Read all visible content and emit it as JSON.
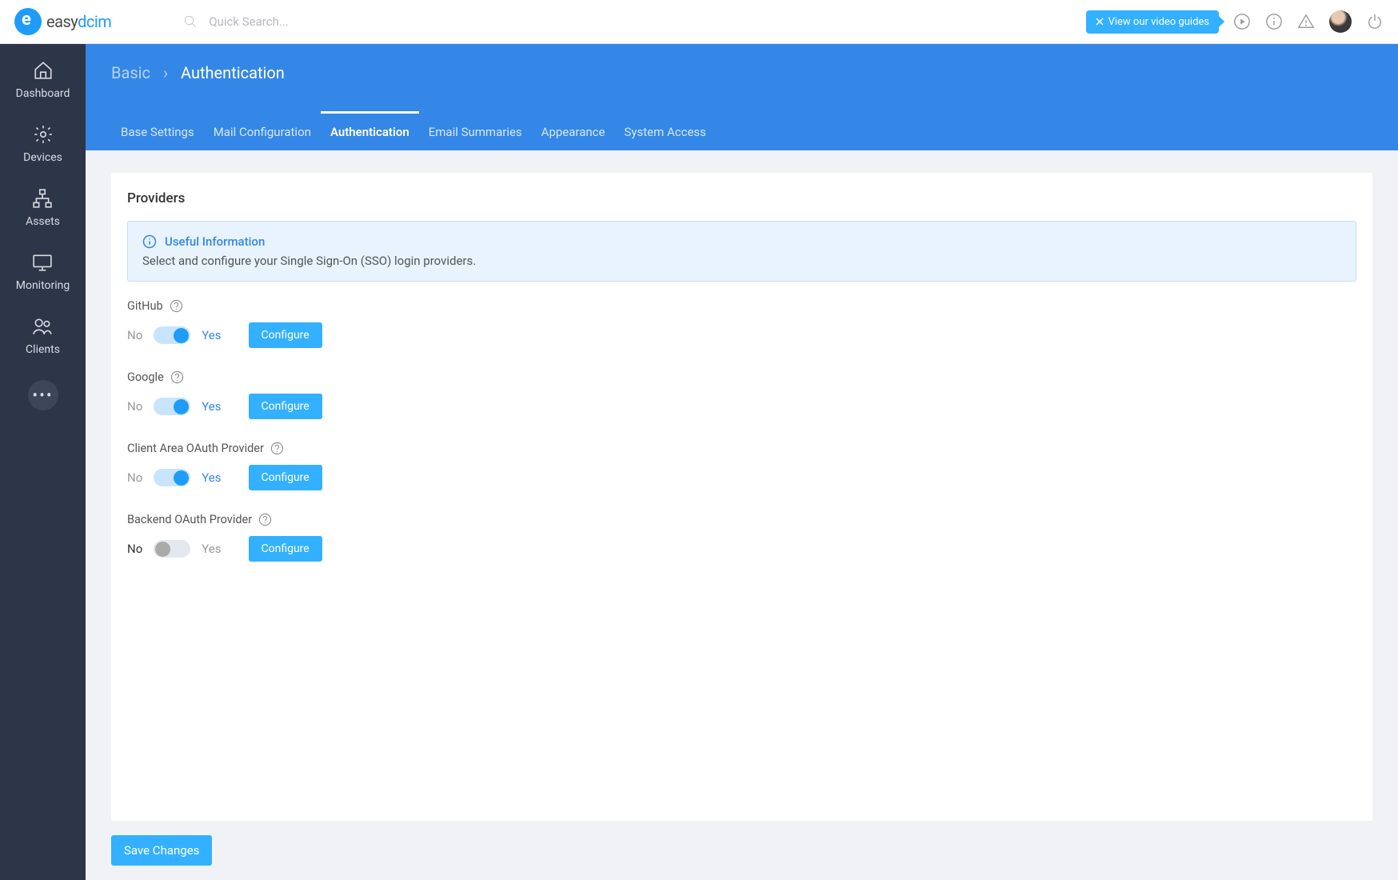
{
  "logo": {
    "text_easy": "easy",
    "text_dcim": "dcim"
  },
  "search": {
    "placeholder": "Quick Search..."
  },
  "header": {
    "video_guides": "View our video guides"
  },
  "sidebar": {
    "items": [
      {
        "label": "Dashboard"
      },
      {
        "label": "Devices"
      },
      {
        "label": "Assets"
      },
      {
        "label": "Monitoring"
      },
      {
        "label": "Clients"
      }
    ]
  },
  "breadcrumb": {
    "first": "Basic",
    "second": "Authentication"
  },
  "tabs": [
    {
      "label": "Base Settings",
      "active": false
    },
    {
      "label": "Mail Configuration",
      "active": false
    },
    {
      "label": "Authentication",
      "active": true
    },
    {
      "label": "Email Summaries",
      "active": false
    },
    {
      "label": "Appearance",
      "active": false
    },
    {
      "label": "System Access",
      "active": false
    }
  ],
  "card": {
    "title": "Providers",
    "info_title": "Useful Information",
    "info_text": "Select and configure your Single Sign-On (SSO) login providers.",
    "labels": {
      "no": "No",
      "yes": "Yes",
      "configure": "Configure"
    },
    "providers": [
      {
        "name": "GitHub",
        "enabled": true
      },
      {
        "name": "Google",
        "enabled": true
      },
      {
        "name": "Client Area OAuth Provider",
        "enabled": true
      },
      {
        "name": "Backend OAuth Provider",
        "enabled": false
      }
    ]
  },
  "save": "Save Changes"
}
